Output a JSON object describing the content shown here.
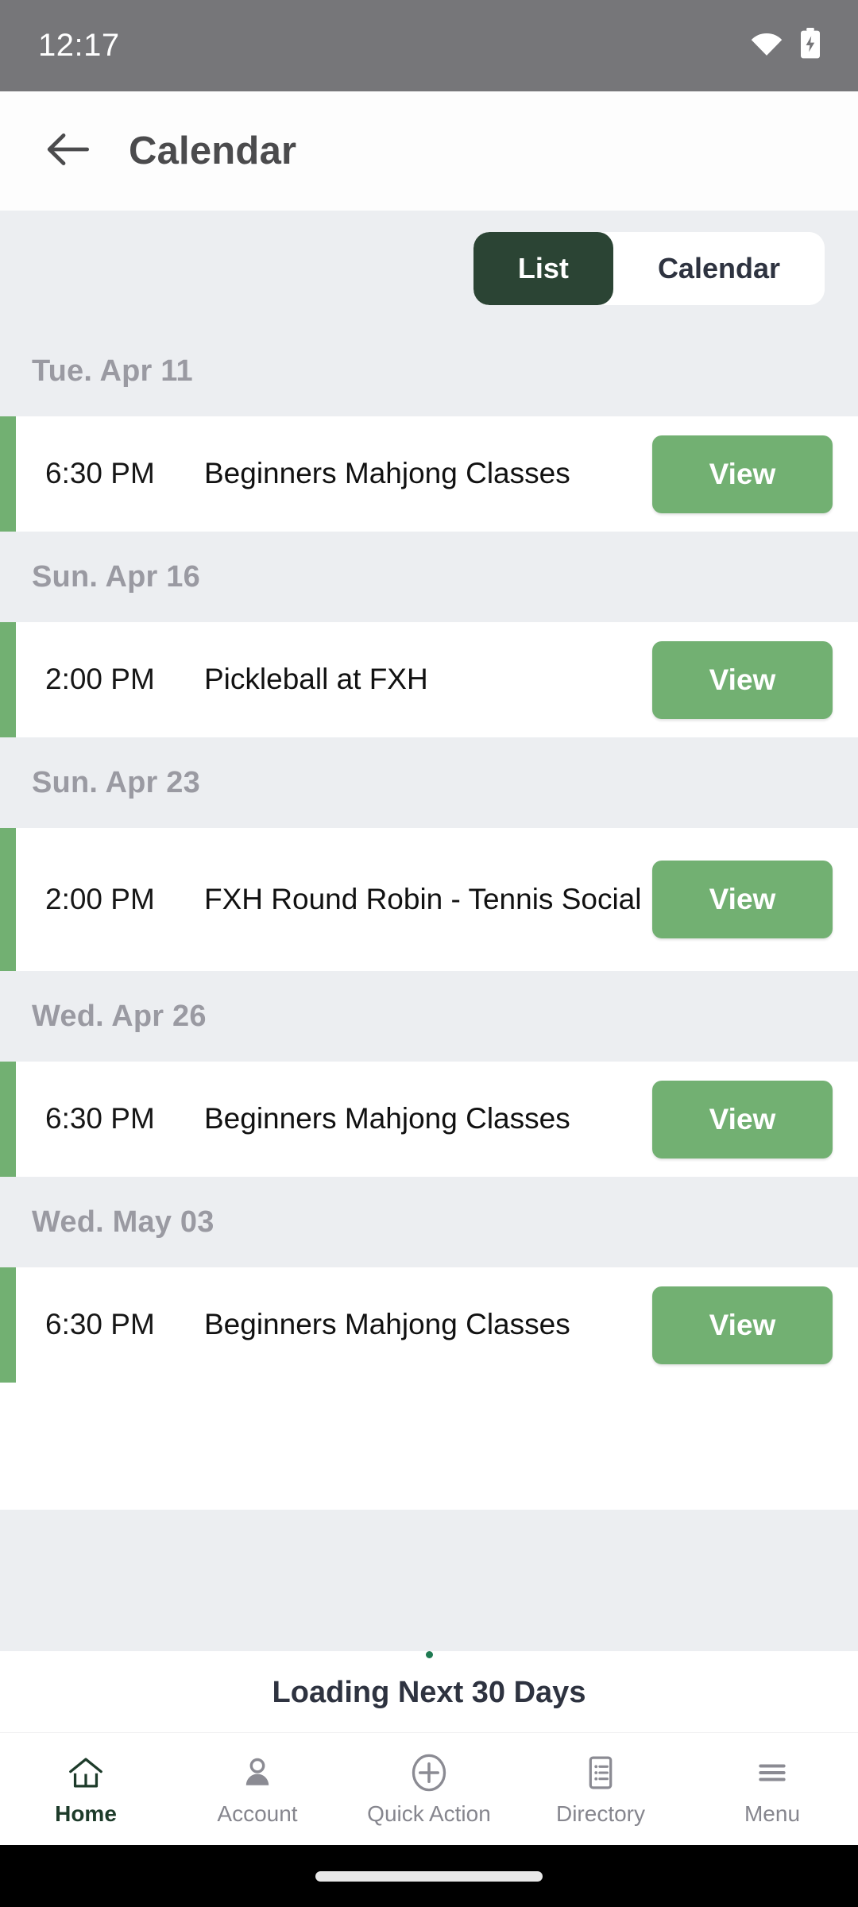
{
  "statusbar": {
    "time": "12:17",
    "icons": [
      "wifi-icon",
      "battery-charging-icon"
    ]
  },
  "header": {
    "back_icon": "arrow-left-icon",
    "title": "Calendar"
  },
  "view_toggle": {
    "options": [
      {
        "label": "List",
        "active": true
      },
      {
        "label": "Calendar",
        "active": false
      }
    ],
    "active_color": "#2b4434",
    "inactive_bg": "#ffffff"
  },
  "accent_color": "#72b072",
  "groups": [
    {
      "date": "Tue. Apr 11",
      "events": [
        {
          "time": "6:30 PM",
          "title": "Beginners Mahjong Classes",
          "action_label": "View"
        }
      ]
    },
    {
      "date": "Sun. Apr 16",
      "events": [
        {
          "time": "2:00 PM",
          "title": "Pickleball at FXH",
          "action_label": "View"
        }
      ]
    },
    {
      "date": "Sun. Apr 23",
      "events": [
        {
          "time": "2:00 PM",
          "title": "FXH Round Robin - Tennis Social",
          "action_label": "View"
        }
      ]
    },
    {
      "date": "Wed. Apr 26",
      "events": [
        {
          "time": "6:30 PM",
          "title": "Beginners Mahjong Classes",
          "action_label": "View"
        }
      ]
    },
    {
      "date": "Wed. May 03",
      "events": [
        {
          "time": "6:30 PM",
          "title": "Beginners Mahjong Classes",
          "action_label": "View"
        }
      ]
    }
  ],
  "loading": {
    "text": "Loading Next 30 Days",
    "spinner_color": "#1f7a52"
  },
  "bottom_nav": {
    "items": [
      {
        "label": "Home",
        "icon": "home-icon",
        "active": true
      },
      {
        "label": "Account",
        "icon": "person-icon",
        "active": false
      },
      {
        "label": "Quick Action",
        "icon": "plus-circle-icon",
        "active": false
      },
      {
        "label": "Directory",
        "icon": "list-document-icon",
        "active": false
      },
      {
        "label": "Menu",
        "icon": "hamburger-icon",
        "active": false
      }
    ]
  }
}
